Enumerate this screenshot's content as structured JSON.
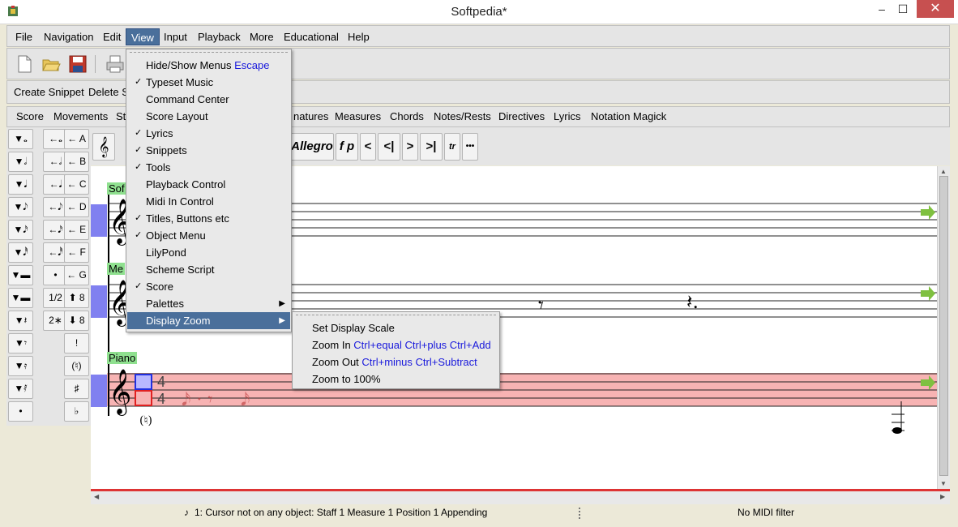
{
  "window": {
    "title": "Softpedia*",
    "minimize": "–",
    "maximize": "☐",
    "close": "✕"
  },
  "menubar": [
    "File",
    "Navigation",
    "Edit",
    "View",
    "Input",
    "Playback",
    "More",
    "Educational",
    "Help"
  ],
  "snippets": {
    "create": "Create Snippet",
    "delete": "Delete S"
  },
  "object_menu": [
    "Score",
    "Movements",
    "St",
    "natures",
    "Measures",
    "Chords",
    "Notes/Rests",
    "Directives",
    "Lyrics",
    "Notation Magick"
  ],
  "palette": {
    "rows": [
      [
        "▼𝅝",
        "←𝅝",
        "← A"
      ],
      [
        "▼𝅗𝅥",
        "←𝅗𝅥",
        "← B"
      ],
      [
        "▼𝅘𝅥",
        "←𝅘𝅥",
        "← C"
      ],
      [
        "▼𝅘𝅥𝅮",
        "←𝅘𝅥𝅮",
        "← D"
      ],
      [
        "▼𝅘𝅥𝅯",
        "←𝅘𝅥𝅯",
        "← E"
      ],
      [
        "▼𝅘𝅥𝅰",
        "←𝅘𝅥𝅰",
        "← F"
      ],
      [
        "▼▬",
        "•",
        "← G"
      ],
      [
        "▼▬",
        "1/2",
        "⬆ 8"
      ],
      [
        "▼𝄽",
        "2∗",
        "⬇ 8"
      ],
      [
        "▼𝄾",
        "",
        "!"
      ],
      [
        "▼𝄿",
        "",
        "(♮)"
      ],
      [
        "▼𝅀",
        "",
        "♯"
      ],
      [
        "•",
        "",
        "♭"
      ]
    ]
  },
  "musicbar": [
    "𝄞",
    "Allegro",
    "f p",
    "<",
    "<|",
    ">",
    ">|",
    "tr",
    "•••"
  ],
  "staves": [
    {
      "label": "Sof"
    },
    {
      "label": "Me"
    },
    {
      "label": "Piano",
      "time_top": "4",
      "time_bottom": "4"
    }
  ],
  "view_menu": {
    "items": [
      {
        "label": "Hide/Show Menus",
        "accel": "Escape",
        "checked": false
      },
      {
        "label": "Typeset Music",
        "accel": "",
        "checked": true
      },
      {
        "label": "Command Center",
        "accel": "",
        "checked": false
      },
      {
        "label": "Score Layout",
        "accel": "",
        "checked": false
      },
      {
        "label": "Lyrics",
        "accel": "",
        "checked": true
      },
      {
        "label": "Snippets",
        "accel": "",
        "checked": true
      },
      {
        "label": "Tools",
        "accel": "",
        "checked": true
      },
      {
        "label": "Playback Control",
        "accel": "",
        "checked": false
      },
      {
        "label": "Midi In Control",
        "accel": "",
        "checked": false
      },
      {
        "label": "Titles, Buttons etc",
        "accel": "",
        "checked": true
      },
      {
        "label": "Object Menu",
        "accel": "",
        "checked": true
      },
      {
        "label": "LilyPond",
        "accel": "",
        "checked": false
      },
      {
        "label": "Scheme Script",
        "accel": "",
        "checked": false
      },
      {
        "label": "Score",
        "accel": "",
        "checked": true
      },
      {
        "label": "Palettes",
        "accel": "",
        "checked": false,
        "submenu": true
      },
      {
        "label": "Display Zoom",
        "accel": "",
        "checked": false,
        "submenu": true,
        "highlighted": true
      }
    ],
    "check_glyph": "✓",
    "submenu_glyph": "▶"
  },
  "zoom_menu": {
    "items": [
      {
        "label": "Set Display Scale",
        "accel": ""
      },
      {
        "label": "Zoom In",
        "accel": "Ctrl+equal Ctrl+plus Ctrl+Add"
      },
      {
        "label": "Zoom Out",
        "accel": "Ctrl+minus Ctrl+Subtract"
      },
      {
        "label": "Zoom to 100%",
        "accel": ""
      }
    ]
  },
  "status": {
    "left": "1: Cursor not on any object:  Staff 1 Measure 1 Position 1 Appending",
    "right": "No MIDI filter"
  },
  "colors": {
    "accent": "#4a6f9b",
    "accel": "#1a1adc",
    "piano_highlight": "#f7b3b3",
    "cursor_blue": "#2030e0",
    "cursor_red": "#e02020",
    "label_green": "#8fe08f",
    "staff_marker": "#8080f0"
  }
}
